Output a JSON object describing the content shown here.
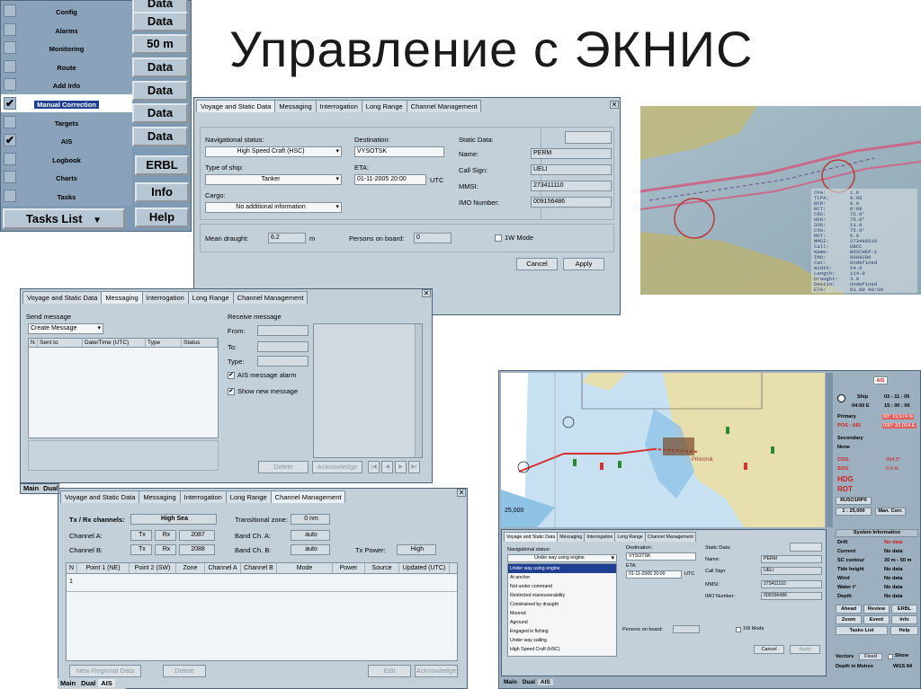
{
  "title": "Управление с ЭКНИС",
  "tasks_menu": {
    "items": [
      {
        "label": "Config",
        "checked": false
      },
      {
        "label": "Alarms",
        "checked": false
      },
      {
        "label": "Monitoring",
        "checked": false
      },
      {
        "label": "Route",
        "checked": false
      },
      {
        "label": "Add Info",
        "checked": false
      },
      {
        "label": "Manual Correction",
        "checked": true
      },
      {
        "label": "Targets",
        "checked": false
      },
      {
        "label": "AIS",
        "checked": true
      },
      {
        "label": "Logbook",
        "checked": false
      },
      {
        "label": "Charts",
        "checked": false
      },
      {
        "label": "Tasks",
        "checked": false
      }
    ],
    "side_buttons": [
      "Data",
      "Data",
      "50 m",
      "Data",
      "Data",
      "Data",
      "Data",
      "ERBL",
      "Info",
      "Help"
    ],
    "tasks_list_label": "Tasks List"
  },
  "voyage_dialog": {
    "tabs": [
      "Voyage and Static Data",
      "Messaging",
      "Interrogation",
      "Long Range",
      "Channel Management"
    ],
    "nav_status_label": "Navigational status:",
    "nav_status_value": "High Speed Craft (HSC)",
    "type_label": "Type of ship:",
    "type_value": "Tanker",
    "cargo_label": "Cargo:",
    "cargo_value": "No additional information",
    "destination_label": "Destination:",
    "destination_value": "VYSOTSK",
    "eta_label": "ETA:",
    "eta_value": "01-11-2005 20:00",
    "eta_unit": "UTC",
    "static_label": "Static Data:",
    "name_label": "Name:",
    "name_value": "PERM",
    "callsign_label": "Call Sign:",
    "callsign_value": "UELI",
    "mmsi_label": "MMSI:",
    "mmsi_value": "273411110",
    "imo_label": "IMO Number:",
    "imo_value": "009156486",
    "draught_label": "Mean draught:",
    "draught_value": "6.2",
    "draught_unit": "m",
    "persons_label": "Persons on board:",
    "persons_value": "0",
    "mode_label": "1W Mode",
    "cancel_label": "Cancel",
    "apply_label": "Apply",
    "close_glyph": "✕"
  },
  "messaging_dialog": {
    "tabs": [
      "Voyage and Static Data",
      "Messaging",
      "Interrogation",
      "Long Range",
      "Channel Management"
    ],
    "send_label": "Send message",
    "create_label": "Create Message",
    "columns": [
      "N",
      "Sent to",
      "Date/Time (UTC)",
      "Type",
      "Status"
    ],
    "receive_label": "Receive message",
    "from_label": "From:",
    "to_label": "To:",
    "type_label": "Type:",
    "alarm_label": "AIS message alarm",
    "show_label": "Show new message",
    "btn_delete": "Delete",
    "btn_acknowledge": "Acknowledge",
    "nav_buttons": [
      "|◀",
      "◀",
      "▶",
      "▶|"
    ],
    "close_glyph": "✕"
  },
  "channel_dialog": {
    "tabs": [
      "Voyage and Static Data",
      "Messaging",
      "Interrogation",
      "Long Range",
      "Channel Management"
    ],
    "txrx_label": "Tx / Rx channels:",
    "txrx_value": "High Sea",
    "transition_label": "Transitional zone:",
    "transition_value": "0 nm",
    "channel_a_label": "Channel A:",
    "channel_b_label": "Channel B:",
    "tx": "Tx",
    "rx": "Rx",
    "channel_a_value": "2087",
    "channel_b_value": "2088",
    "band_a_label": "Band Ch. A:",
    "band_b_label": "Band Ch. B:",
    "band_a_value": "auto",
    "band_b_value": "auto",
    "txpower_label": "Tx Power:",
    "txpower_value": "High",
    "columns": [
      "N",
      "Point 1 (NE)",
      "Point 2 (SW)",
      "Zone",
      "Channel A",
      "Channel B",
      "Mode",
      "Power",
      "Source",
      "Updated (UTC)"
    ],
    "first_row": "1",
    "btn_new": "New Regional Data",
    "btn_delete": "Delete",
    "btn_edit": "Edit",
    "btn_acknowledge": "Acknowledge",
    "bottom_tabs": [
      "Main",
      "Dual",
      "AIS"
    ],
    "close_glyph": "✕"
  },
  "ecdis_screen": {
    "tabs": [
      "Voyage and Static Data",
      "Messaging",
      "Interrogation",
      "Long Range",
      "Channel Management"
    ],
    "nav_label": "Navigational status:",
    "nav_value": "Under way using engine",
    "status_options": [
      "Under way using engine",
      "At anchor",
      "Not under command",
      "Restricted maneuverability",
      "Constrained by draught",
      "Moored",
      "Aground",
      "Engaged in fishing",
      "Under way sailing",
      "High Speed Craft (HSC)"
    ],
    "destination_label": "Destination:",
    "destination_value": "VYSOTSK",
    "eta_label": "ETA:",
    "eta_value": "01-11-2005 20:00",
    "eta_unit": "UTC",
    "static_label": "Static Data:",
    "name_label": "Name:",
    "name_value": "PERM",
    "callsign_label": "Call Sign:",
    "callsign_value": "UELI",
    "mmsi_label": "MMSI:",
    "mmsi_value": "273411110",
    "imo_label": "IMO Number:",
    "imo_value": "009156486",
    "persons_label": "Persons on board:",
    "mode_label": "1W Mode",
    "cancel_label": "Cancel",
    "apply_label": "Apply",
    "bottom_tabs": [
      "Main",
      "Dual",
      "AIS"
    ],
    "map_scale": "25,000",
    "map_label": "Primorsk",
    "side": {
      "ais_badge": "AIS",
      "ship": "Ship",
      "date": "03 - 11 - 05",
      "time1": "04:00 Е",
      "time2": "15 : 00 : 00",
      "primary": "Primary",
      "pos1": "60° 19.574 N",
      "pos_tag": "POS : AIS",
      "pos2": "030° 32.014 E",
      "secondary": "Secondary",
      "none": "None",
      "cog": "COG",
      "cog_val": "094.5°",
      "sog": "SOG",
      "sog_val": "0.0 kt",
      "hdg": "HDG",
      "rot": "ROT",
      "chart_id": "RU5O1RP0",
      "scale": "1 : 25,000",
      "man_corr": "Man. Corr.",
      "sys_info": "System Information",
      "rows": [
        {
          "k": "Drift",
          "v": "No data"
        },
        {
          "k": "Current",
          "v": "No data"
        },
        {
          "k": "SC contour",
          "v": "30 m - 50 m"
        },
        {
          "k": "Tide height",
          "v": "No data"
        },
        {
          "k": "Wind",
          "v": "No data"
        },
        {
          "k": "Water t°",
          "v": "No data"
        },
        {
          "k": "Depth",
          "v": "No data"
        }
      ],
      "buttons": [
        "Ahead",
        "Review",
        "ERBL",
        "Zoom",
        "Event",
        "Info",
        "Tasks List",
        "Help"
      ],
      "vectors": "Vectors",
      "fixed": "Fixed",
      "show": "Show",
      "depth": "Depth in Metres",
      "datum": "WGS 84"
    }
  },
  "chart_photo": {
    "readout": [
      "CPA:",
      "TCPA:",
      "BCR:",
      "BCT:",
      "CRS:",
      "HDG:",
      "SOG:",
      "COG:",
      "ROT:",
      "MMSI:",
      "Call:",
      "Name:",
      "IMO:",
      "Cat:",
      "Width:",
      "Length:",
      "Draught:",
      "Destin:",
      "ETA:"
    ],
    "values": [
      "1.6",
      "0:05",
      "0.0",
      "0:08",
      "75.0°",
      "75.0°",
      "11.0",
      "75.0°",
      "0.0",
      "273440510",
      "UBCC",
      "BOSCHEP-1",
      "8009290",
      "Undefined",
      "14.0",
      "114.0",
      "3.8",
      "Undefined",
      "01.00 00:00"
    ]
  }
}
